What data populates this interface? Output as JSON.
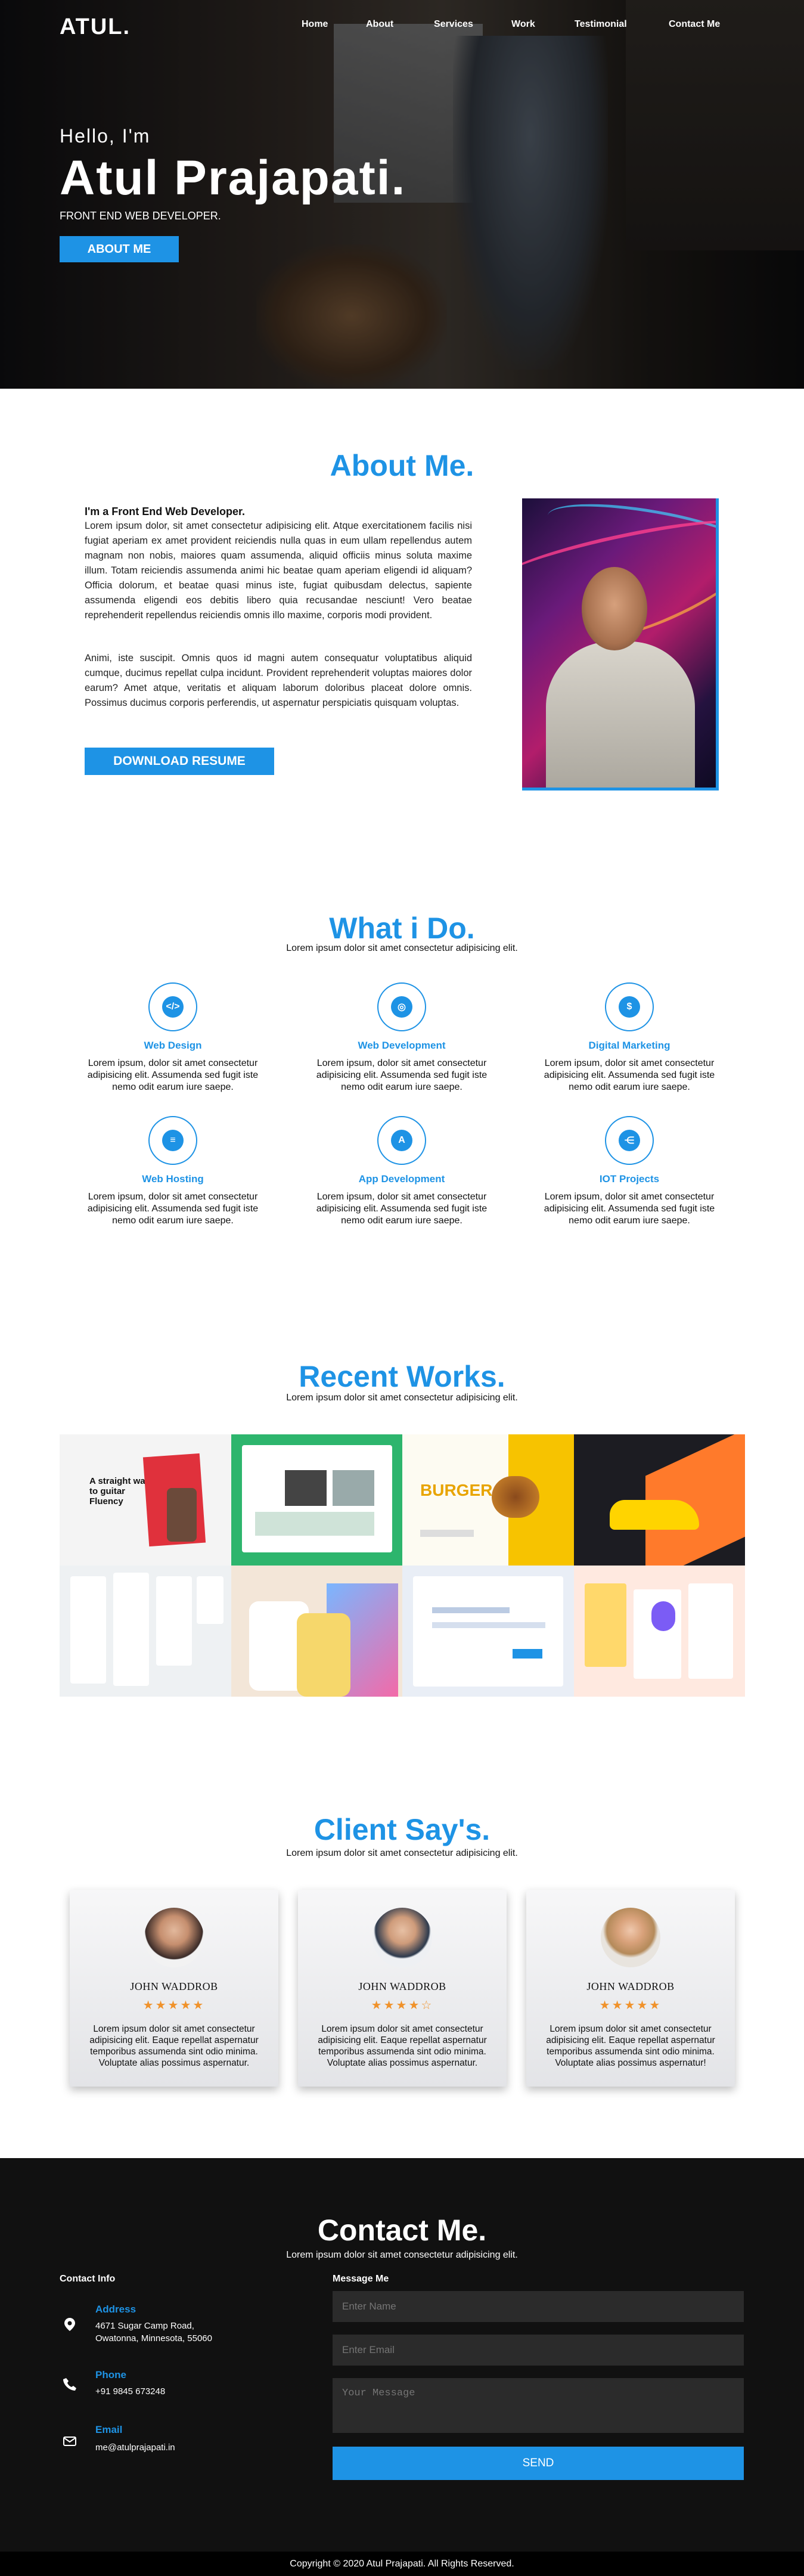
{
  "header": {
    "logo": "ATUL.",
    "nav": [
      "Home",
      "About",
      "Services",
      "Work",
      "Testimonial",
      "Contact Me"
    ]
  },
  "hero": {
    "greeting": "Hello, I'm",
    "name": "Atul Prajapati.",
    "role": "FRONT END WEB DEVELOPER.",
    "button": "ABOUT ME"
  },
  "about": {
    "title": "About Me.",
    "heading": "I'm a Front End Web Developer.",
    "para1": "Lorem ipsum dolor, sit amet consectetur adipisicing elit. Atque exercitationem facilis nisi fugiat aperiam ex amet provident reiciendis nulla quas in eum ullam repellendus autem magnam non nobis, maiores quam assumenda, aliquid officiis minus soluta maxime illum. Totam reiciendis assumenda animi hic beatae quam aperiam eligendi id aliquam? Officia dolorum, et beatae quasi minus iste, fugiat quibusdam delectus, sapiente assumenda eligendi eos debitis libero quia recusandae nesciunt! Vero beatae reprehenderit repellendus reiciendis omnis illo maxime, corporis modi provident.",
    "para2": "Animi, iste suscipit. Omnis quos id magni autem consequatur voluptatibus aliquid cumque, ducimus repellat culpa incidunt. Provident reprehenderit voluptas maiores dolor earum? Amet atque, veritatis et aliquam laborum doloribus placeat dolore omnis. Possimus ducimus corporis perferendis, ut aspernatur perspiciatis quisquam voluptas.",
    "button": "DOWNLOAD RESUME"
  },
  "services": {
    "title": "What i Do.",
    "subtitle": "Lorem ipsum dolor sit amet consectetur adipisicing elit.",
    "items": [
      {
        "title": "Web Design",
        "desc": "Lorem ipsum, dolor sit amet consectetur adipisicing elit. Assumenda sed fugit iste nemo odit earum iure saepe.",
        "icon": "code-icon",
        "glyph": "</>"
      },
      {
        "title": "Web Development",
        "desc": "Lorem ipsum, dolor sit amet consectetur adipisicing elit. Assumenda sed fugit iste nemo odit earum iure saepe.",
        "icon": "globe-icon",
        "glyph": "◎"
      },
      {
        "title": "Digital Marketing",
        "desc": "Lorem ipsum, dolor sit amet consectetur adipisicing elit. Assumenda sed fugit iste nemo odit earum iure saepe.",
        "icon": "funnel-dollar-icon",
        "glyph": "$"
      },
      {
        "title": "Web Hosting",
        "desc": "Lorem ipsum, dolor sit amet consectetur adipisicing elit. Assumenda sed fugit iste nemo odit earum iure saepe.",
        "icon": "server-icon",
        "glyph": "≡"
      },
      {
        "title": "App Development",
        "desc": "Lorem ipsum, dolor sit amet consectetur adipisicing elit. Assumenda sed fugit iste nemo odit earum iure saepe.",
        "icon": "app-store-icon",
        "glyph": "A"
      },
      {
        "title": "IOT Projects",
        "desc": "Lorem ipsum, dolor sit amet consectetur adipisicing elit. Assumenda sed fugit iste nemo odit earum iure saepe.",
        "icon": "share-nodes-icon",
        "glyph": "⋲"
      }
    ]
  },
  "works": {
    "title": "Recent Works.",
    "subtitle": "Lorem ipsum dolor sit amet consectetur adipisicing elit.",
    "thumb_texts": [
      "A straight way to guitar Fluency",
      "BURGER"
    ]
  },
  "testimonials": {
    "title": "Client Say's.",
    "subtitle": "Lorem ipsum dolor sit amet consectetur adipisicing elit.",
    "items": [
      {
        "name": "JOHN WADDROB",
        "rating": 5,
        "stars": "★★★★★",
        "text": "Lorem ipsum dolor sit amet consectetur adipisicing elit. Eaque repellat aspernatur temporibus assumenda sint odio minima. Voluptate alias possimus aspernatur."
      },
      {
        "name": "JOHN WADDROB",
        "rating": 4,
        "stars": "★★★★☆",
        "text": "Lorem ipsum dolor sit amet consectetur adipisicing elit. Eaque repellat aspernatur temporibus assumenda sint odio minima. Voluptate alias possimus aspernatur."
      },
      {
        "name": "JOHN WADDROB",
        "rating": 5,
        "stars": "★★★★★",
        "text": "Lorem ipsum dolor sit amet consectetur adipisicing elit. Eaque repellat aspernatur temporibus assumenda sint odio minima. Voluptate alias possimus aspernatur!"
      }
    ]
  },
  "contact": {
    "title": "Contact Me.",
    "subtitle": "Lorem ipsum dolor sit amet consectetur adipisicing elit.",
    "info_label": "Contact Info",
    "message_label": "Message Me",
    "address_title": "Address",
    "address_line1": "4671 Sugar Camp Road,",
    "address_line2": "Owatonna, Minnesota, 55060",
    "phone_title": "Phone",
    "phone": "+91 9845 673248",
    "email_title": "Email",
    "email": "me@atulprajapati.in",
    "name_placeholder": "Enter Name",
    "email_placeholder": "Enter Email",
    "message_placeholder": "Your Message",
    "send": "SEND"
  },
  "footer": {
    "text": "Copyright © 2020 Atul Prajapati. All Rights Reserved."
  },
  "colors": {
    "accent": "#1e93e5",
    "star": "#f0922b",
    "dark": "#111111"
  }
}
